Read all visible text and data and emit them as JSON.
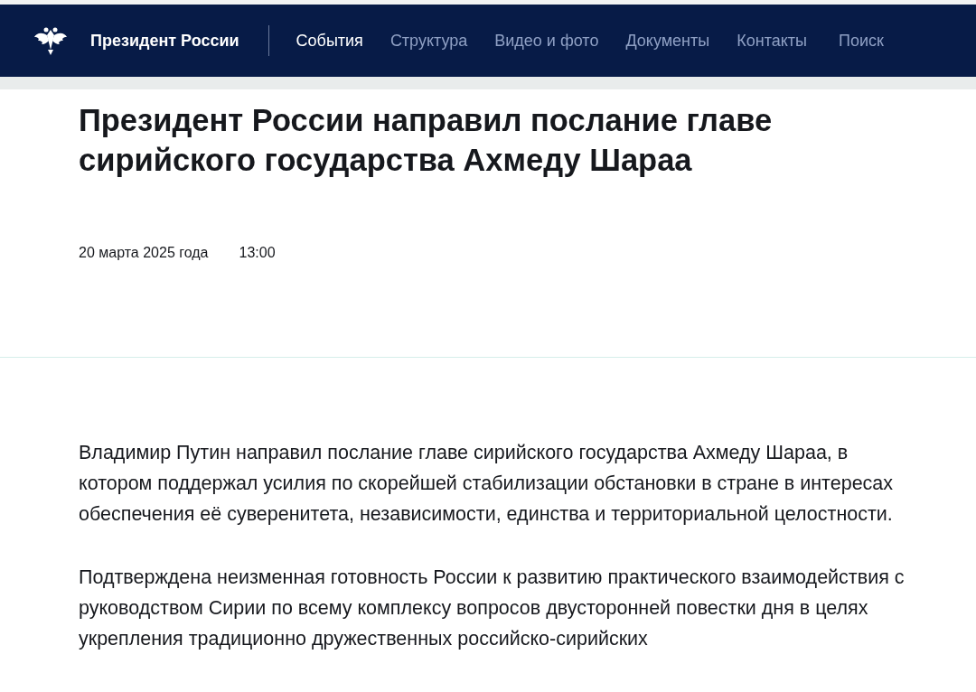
{
  "header": {
    "site_title": "Президент России",
    "nav": [
      {
        "label": "События",
        "selected": true
      },
      {
        "label": "Структура",
        "selected": false
      },
      {
        "label": "Видео и фото",
        "selected": false
      },
      {
        "label": "Документы",
        "selected": false
      },
      {
        "label": "Контакты",
        "selected": false
      }
    ],
    "search": "Поиск"
  },
  "article": {
    "title": "Президент России направил послание главе сирийского государства Ахмеду Шараа",
    "date": "20 марта 2025 года",
    "time": "13:00",
    "paragraphs": [
      "Владимир Путин направил послание главе сирийского государства Ахмеду Шараа, в котором поддержал усилия по скорейшей стабилизации обстановки в стране в интересах обеспечения её суверенитета, независимости, единства и территориальной целостности.",
      "Подтверждена неизменная готовность России к развитию практического взаимодействия с руководством Сирии по всему комплексу вопросов двусторонней повестки дня в целях укрепления традиционно дружественных российско-сирийских"
    ]
  }
}
